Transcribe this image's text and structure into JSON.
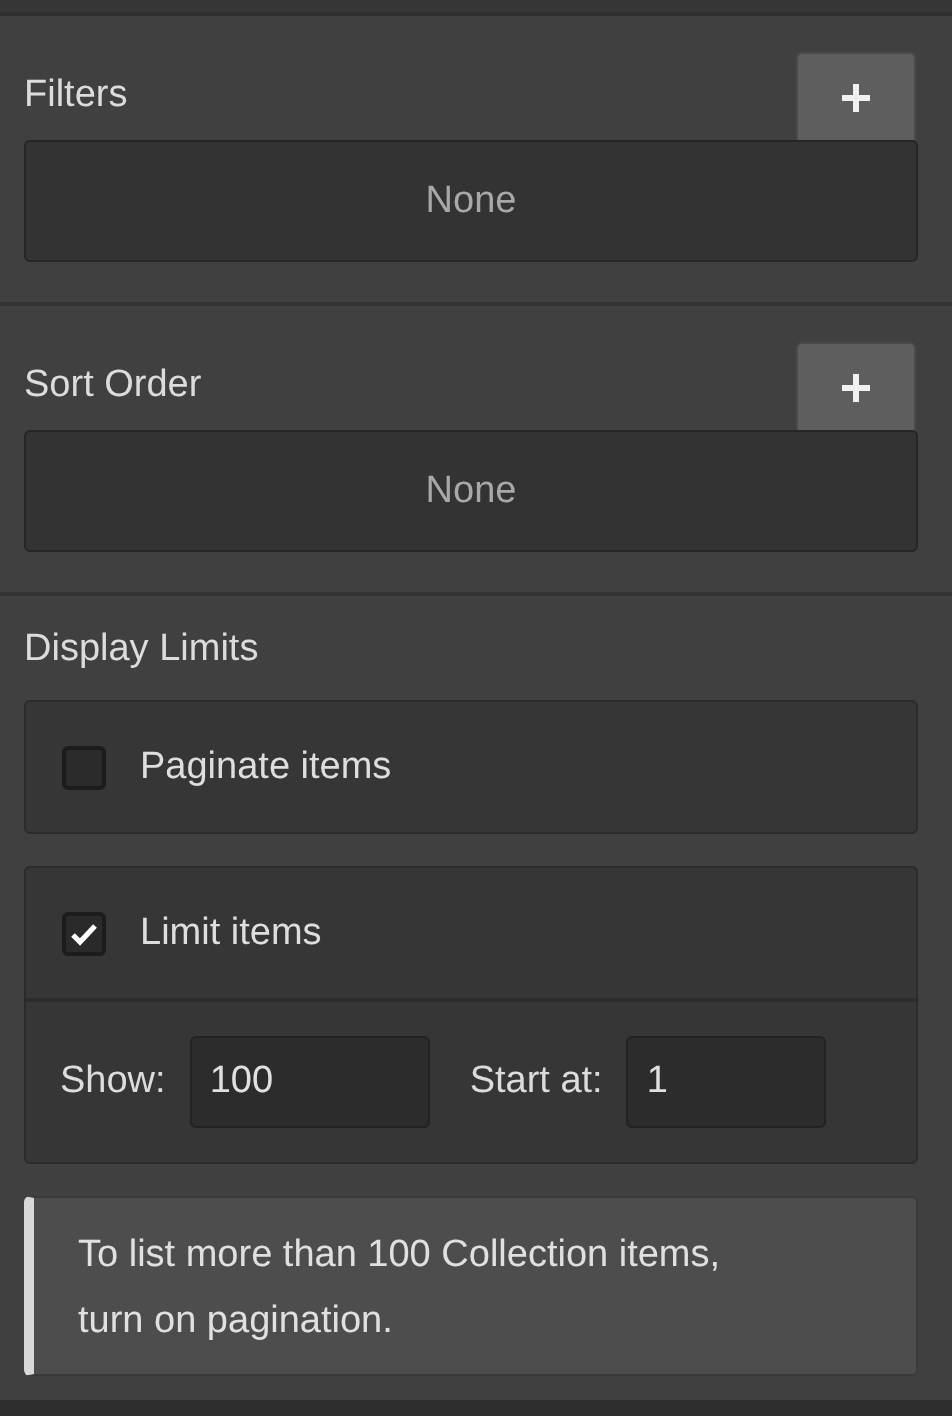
{
  "sections": [
    {
      "kind": "list",
      "title": "Filters",
      "empty_text": "None"
    },
    {
      "kind": "list",
      "title": "Sort Order",
      "empty_text": "None"
    },
    {
      "kind": "limits",
      "title": "Display Limits",
      "options": [
        {
          "label": "Paginate items",
          "checked": false
        },
        {
          "label": "Limit items",
          "checked": true,
          "fields": [
            {
              "label": "Show:",
              "value": "100"
            },
            {
              "label": "Start at:",
              "value": "1"
            }
          ]
        }
      ],
      "note": "To list more than 100 Collection items, turn on pagination."
    }
  ]
}
